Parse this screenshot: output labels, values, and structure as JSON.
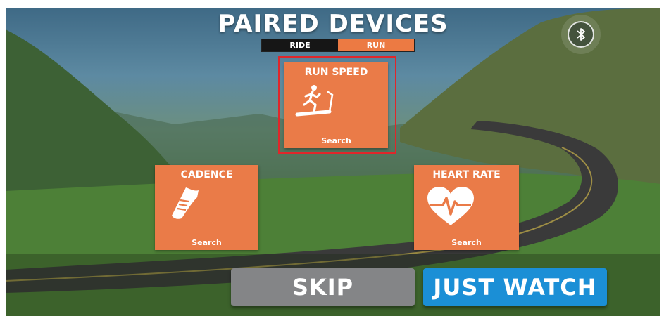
{
  "header": {
    "title": "PAIRED DEVICES"
  },
  "mode_toggle": {
    "options": [
      "RIDE",
      "RUN"
    ],
    "selected": "RUN"
  },
  "bluetooth": {
    "icon": "bluetooth-icon"
  },
  "devices": {
    "run_speed": {
      "title": "RUN SPEED",
      "status": "Search",
      "icon": "treadmill-runner-icon"
    },
    "cadence": {
      "title": "CADENCE",
      "status": "Search",
      "icon": "running-shoe-icon"
    },
    "heart_rate": {
      "title": "HEART RATE",
      "status": "Search",
      "icon": "heart-pulse-icon"
    }
  },
  "actions": {
    "skip_label": "SKIP",
    "watch_label": "JUST WATCH"
  },
  "colors": {
    "tile": "#ea7b48",
    "run_toggle": "#ec7a43",
    "ride_toggle": "#161616",
    "skip": "#848587",
    "watch": "#1b8fd6",
    "highlight": "#e0262a"
  }
}
